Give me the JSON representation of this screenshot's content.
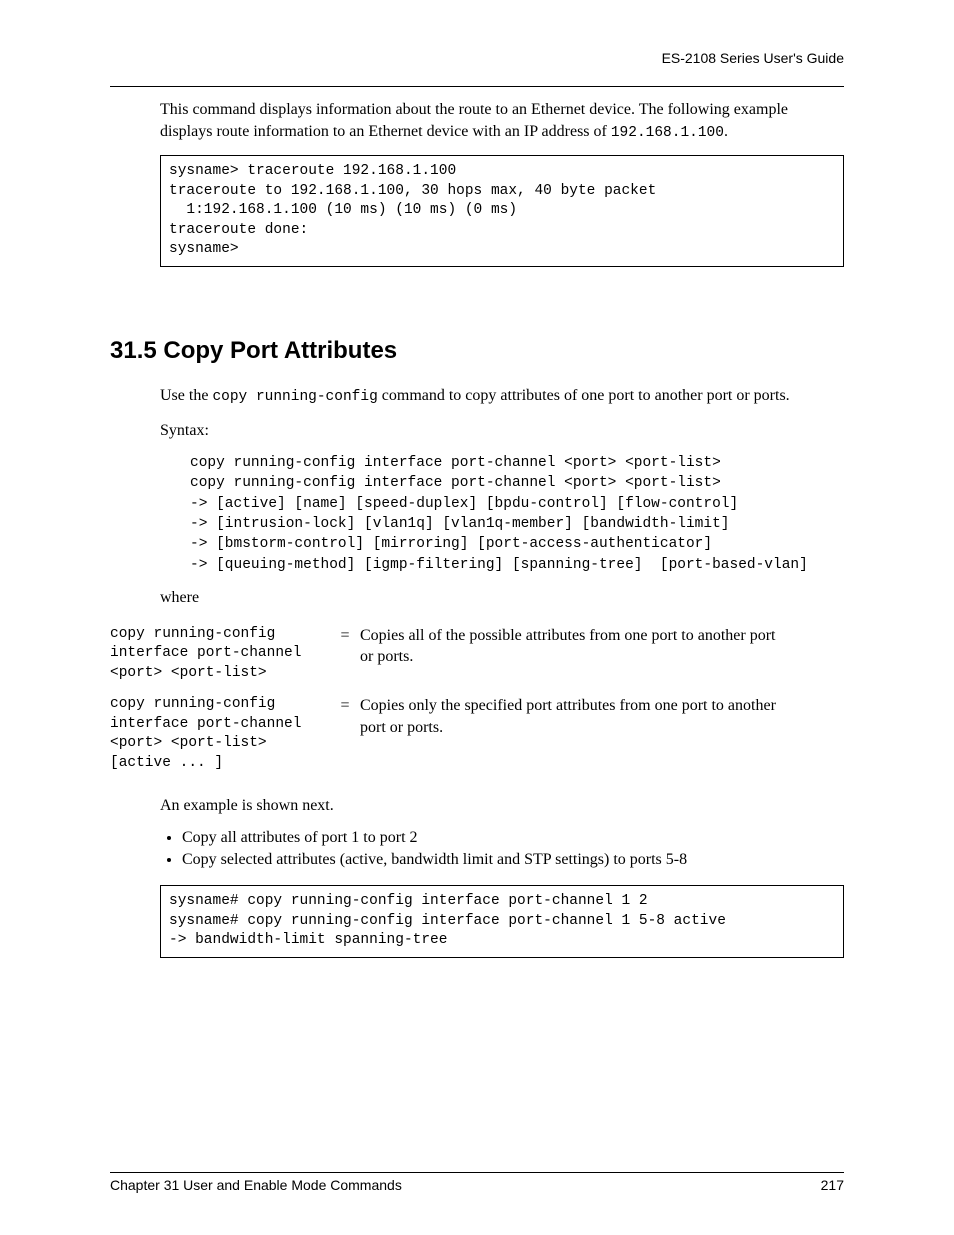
{
  "header": {
    "guide_title": "ES-2108 Series User's Guide"
  },
  "intro": {
    "para_before_ip": "This command displays information about the route to an Ethernet device. The following example displays route information to an Ethernet device with an IP address of ",
    "ip_code": "192.168.1.100",
    "period": "."
  },
  "codebox1": "sysname> traceroute 192.168.1.100\ntraceroute to 192.168.1.100, 30 hops max, 40 byte packet\n  1:192.168.1.100 (10 ms) (10 ms) (0 ms)\ntraceroute done:\nsysname>",
  "section": {
    "number_title": "31.5  Copy Port Attributes"
  },
  "usage": {
    "prefix": "Use the ",
    "cmd": "copy running-config",
    "suffix": " command to copy attributes of one port to another port or ports."
  },
  "syntax_label": "Syntax:",
  "syntax_block": "copy running-config interface port-channel <port> <port-list>\ncopy running-config interface port-channel <port> <port-list>\n-> [active] [name] [speed-duplex] [bpdu-control] [flow-control]\n-> [intrusion-lock] [vlan1q] [vlan1q-member] [bandwidth-limit]\n-> [bmstorm-control] [mirroring] [port-access-authenticator]\n-> [queuing-method] [igmp-filtering] [spanning-tree]  [port-based-vlan]",
  "where_label": "where",
  "defs": [
    {
      "term": "copy running-config interface port-channel <port> <port-list>",
      "eq": "=",
      "desc": "Copies all of the possible attributes from one port to another port or ports."
    },
    {
      "term": "copy running-config interface port-channel <port> <port-list> [active ... ]",
      "eq": "=",
      "desc": "Copies only the specified port attributes from one port to another port or ports."
    }
  ],
  "example_intro": "An example is shown next.",
  "bullets": [
    "Copy all attributes of port 1 to port 2",
    "Copy selected attributes (active, bandwidth limit and STP settings) to ports 5-8"
  ],
  "codebox2": "sysname# copy running-config interface port-channel 1 2\nsysname# copy running-config interface port-channel 1 5-8 active\n-> bandwidth-limit spanning-tree",
  "footer": {
    "left": "Chapter 31  User and Enable Mode Commands",
    "right": "217"
  }
}
